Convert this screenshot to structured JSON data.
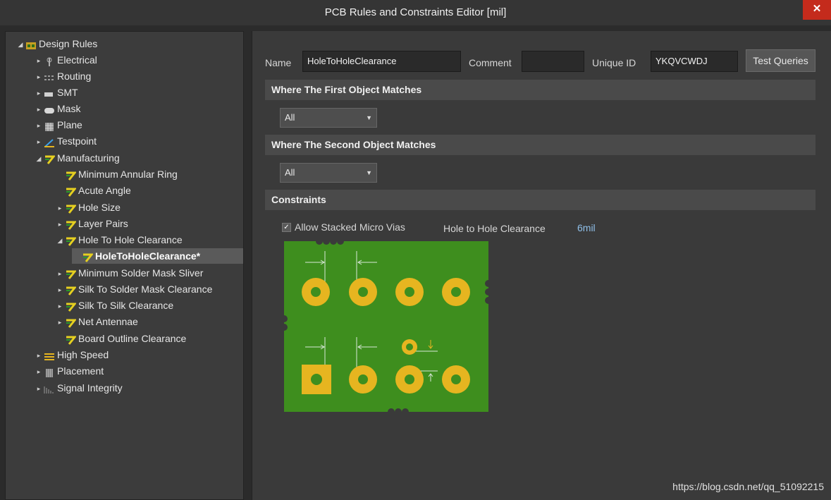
{
  "window": {
    "title": "PCB Rules and Constraints Editor [mil]",
    "close_glyph": "✕"
  },
  "tree": {
    "items": [
      {
        "label": "Design Rules",
        "arrow": "◢",
        "icon": "design-rules-icon"
      },
      {
        "label": "Electrical",
        "arrow": "▸",
        "icon": "electrical-icon"
      },
      {
        "label": "Routing",
        "arrow": "▸",
        "icon": "routing-icon"
      },
      {
        "label": "SMT",
        "arrow": "▸",
        "icon": "smt-icon"
      },
      {
        "label": "Mask",
        "arrow": "▸",
        "icon": "mask-icon"
      },
      {
        "label": "Plane",
        "arrow": "▸",
        "icon": "plane-icon"
      },
      {
        "label": "Testpoint",
        "arrow": "▸",
        "icon": "testpoint-icon"
      },
      {
        "label": "Manufacturing",
        "arrow": "◢",
        "icon": "manufacturing-icon"
      },
      {
        "label": "Minimum Annular Ring",
        "arrow": "",
        "icon": "manufacturing-rule-icon"
      },
      {
        "label": "Acute Angle",
        "arrow": "",
        "icon": "manufacturing-rule-icon"
      },
      {
        "label": "Hole Size",
        "arrow": "▸",
        "icon": "manufacturing-rule-icon"
      },
      {
        "label": "Layer Pairs",
        "arrow": "▸",
        "icon": "manufacturing-rule-icon"
      },
      {
        "label": "Hole To Hole Clearance",
        "arrow": "◢",
        "icon": "manufacturing-rule-icon"
      },
      {
        "label": "HoleToHoleClearance*",
        "arrow": "",
        "icon": "manufacturing-rule-icon"
      },
      {
        "label": "Minimum Solder Mask Sliver",
        "arrow": "▸",
        "icon": "manufacturing-rule-icon"
      },
      {
        "label": "Silk To Solder Mask Clearance",
        "arrow": "▸",
        "icon": "manufacturing-rule-icon"
      },
      {
        "label": "Silk To Silk Clearance",
        "arrow": "▸",
        "icon": "manufacturing-rule-icon"
      },
      {
        "label": "Net Antennae",
        "arrow": "▸",
        "icon": "manufacturing-rule-icon"
      },
      {
        "label": "Board Outline Clearance",
        "arrow": "",
        "icon": "manufacturing-rule-icon"
      },
      {
        "label": "High Speed",
        "arrow": "▸",
        "icon": "high-speed-icon"
      },
      {
        "label": "Placement",
        "arrow": "▸",
        "icon": "placement-icon"
      },
      {
        "label": "Signal Integrity",
        "arrow": "▸",
        "icon": "signal-integrity-icon"
      }
    ]
  },
  "rule": {
    "name_label": "Name",
    "name_value": "HoleToHoleClearance",
    "comment_label": "Comment",
    "comment_value": "",
    "unique_id_label": "Unique ID",
    "unique_id_value": "YKQVCWDJ",
    "test_queries_label": "Test Queries"
  },
  "first_match": {
    "header": "Where The First Object Matches",
    "selected": "All"
  },
  "second_match": {
    "header": "Where The Second Object Matches",
    "selected": "All"
  },
  "constraints": {
    "header": "Constraints",
    "allow_stacked_label": "Allow Stacked Micro Vias",
    "allow_stacked_checked": true,
    "clearance_label": "Hole to Hole Clearance",
    "clearance_value": "6mil"
  },
  "colors": {
    "board_green": "#3e8e1e",
    "pad_yellow": "#e6b520",
    "value_blue": "#8fbfe8",
    "selected_bg": "#5a5a5a",
    "close_red": "#c42b1c"
  },
  "watermark": "https://blog.csdn.net/qq_51092215"
}
